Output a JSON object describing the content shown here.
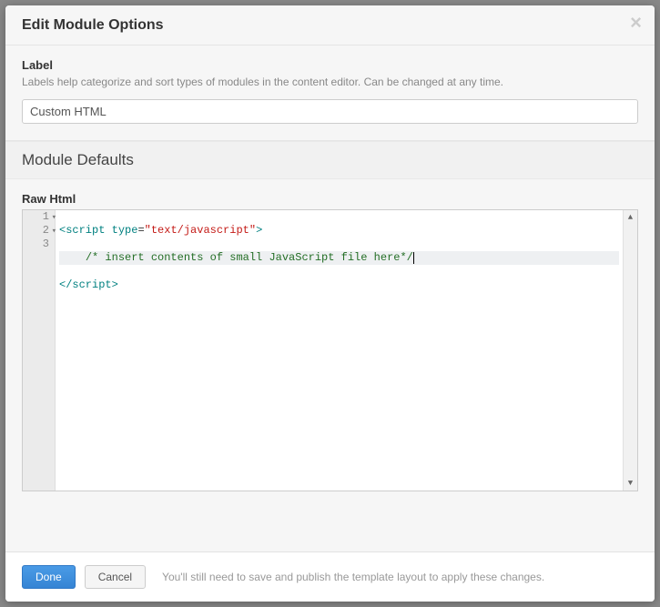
{
  "modal": {
    "title": "Edit Module Options"
  },
  "label_section": {
    "field_label": "Label",
    "help_text": "Labels help categorize and sort types of modules in the content editor. Can be changed at any time.",
    "value": "Custom HTML"
  },
  "defaults_section": {
    "title": "Module Defaults",
    "raw_html_label": "Raw Html",
    "code_lines": [
      {
        "num": "1",
        "foldable": true
      },
      {
        "num": "2",
        "foldable": true,
        "active": true
      },
      {
        "num": "3",
        "foldable": false
      }
    ],
    "tokens": {
      "line1": {
        "open": "<",
        "tag": "script",
        "space": " ",
        "attr": "type",
        "eq": "=",
        "str": "\"text/javascript\"",
        "close": ">"
      },
      "line2": {
        "indent": "    ",
        "comment": "/* insert contents of small JavaScript file here*/"
      },
      "line3": {
        "open": "</",
        "tag": "script",
        "close": ">"
      }
    }
  },
  "footer": {
    "done_label": "Done",
    "cancel_label": "Cancel",
    "hint": "You'll still need to save and publish the template layout to apply these changes."
  }
}
